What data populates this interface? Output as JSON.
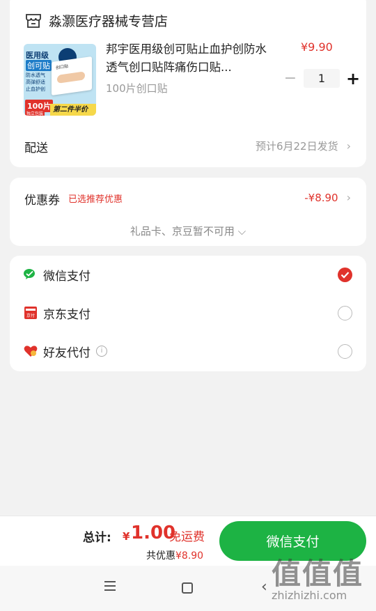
{
  "shop": {
    "name": "淼灏医疗器械专营店"
  },
  "product": {
    "image": {
      "title": "医用级",
      "subtitle": "创可贴",
      "features": [
        "防水透气",
        "高弹舒适",
        "止血护创"
      ],
      "box_label": "创口贴",
      "count": "100片",
      "count_note": "独立包装",
      "promo": "第二件半价"
    },
    "title": "邦宇医用级创可贴止血护创防水透气创口贴阵痛伤口贴...",
    "spec": "100片创口贴",
    "price": "¥9.90",
    "quantity": "1",
    "minus_label": "−",
    "plus_label": "+"
  },
  "delivery": {
    "label": "配送",
    "value": "预计6月22日发货"
  },
  "coupon": {
    "label": "优惠券",
    "tag": "已选推荐优惠",
    "amount": "-¥8.90",
    "note": "礼品卡、京豆暂不可用 ⌵"
  },
  "payment_methods": [
    {
      "label": "微信支付",
      "icon": "wechat-icon",
      "selected": true,
      "color": "#1db344"
    },
    {
      "label": "京东支付",
      "icon": "jd-pay-icon",
      "selected": false,
      "color": "#e0322b"
    },
    {
      "label": "好友代付",
      "icon": "friend-pay-icon",
      "selected": false,
      "color": "#e0322b"
    }
  ],
  "bottom_bar": {
    "total_label": "总计:",
    "currency": "¥",
    "total_amount": "1.00",
    "free_shipping": "免运费",
    "discount_prefix": "共优惠",
    "discount_amount": "¥8.90",
    "pay_button": "微信支付"
  },
  "watermark": {
    "big": "值值值",
    "small": "zhizhizhi.com"
  },
  "colors": {
    "accent_red": "#e0322b",
    "wechat_green": "#1db344",
    "background": "#f2f2f2"
  }
}
